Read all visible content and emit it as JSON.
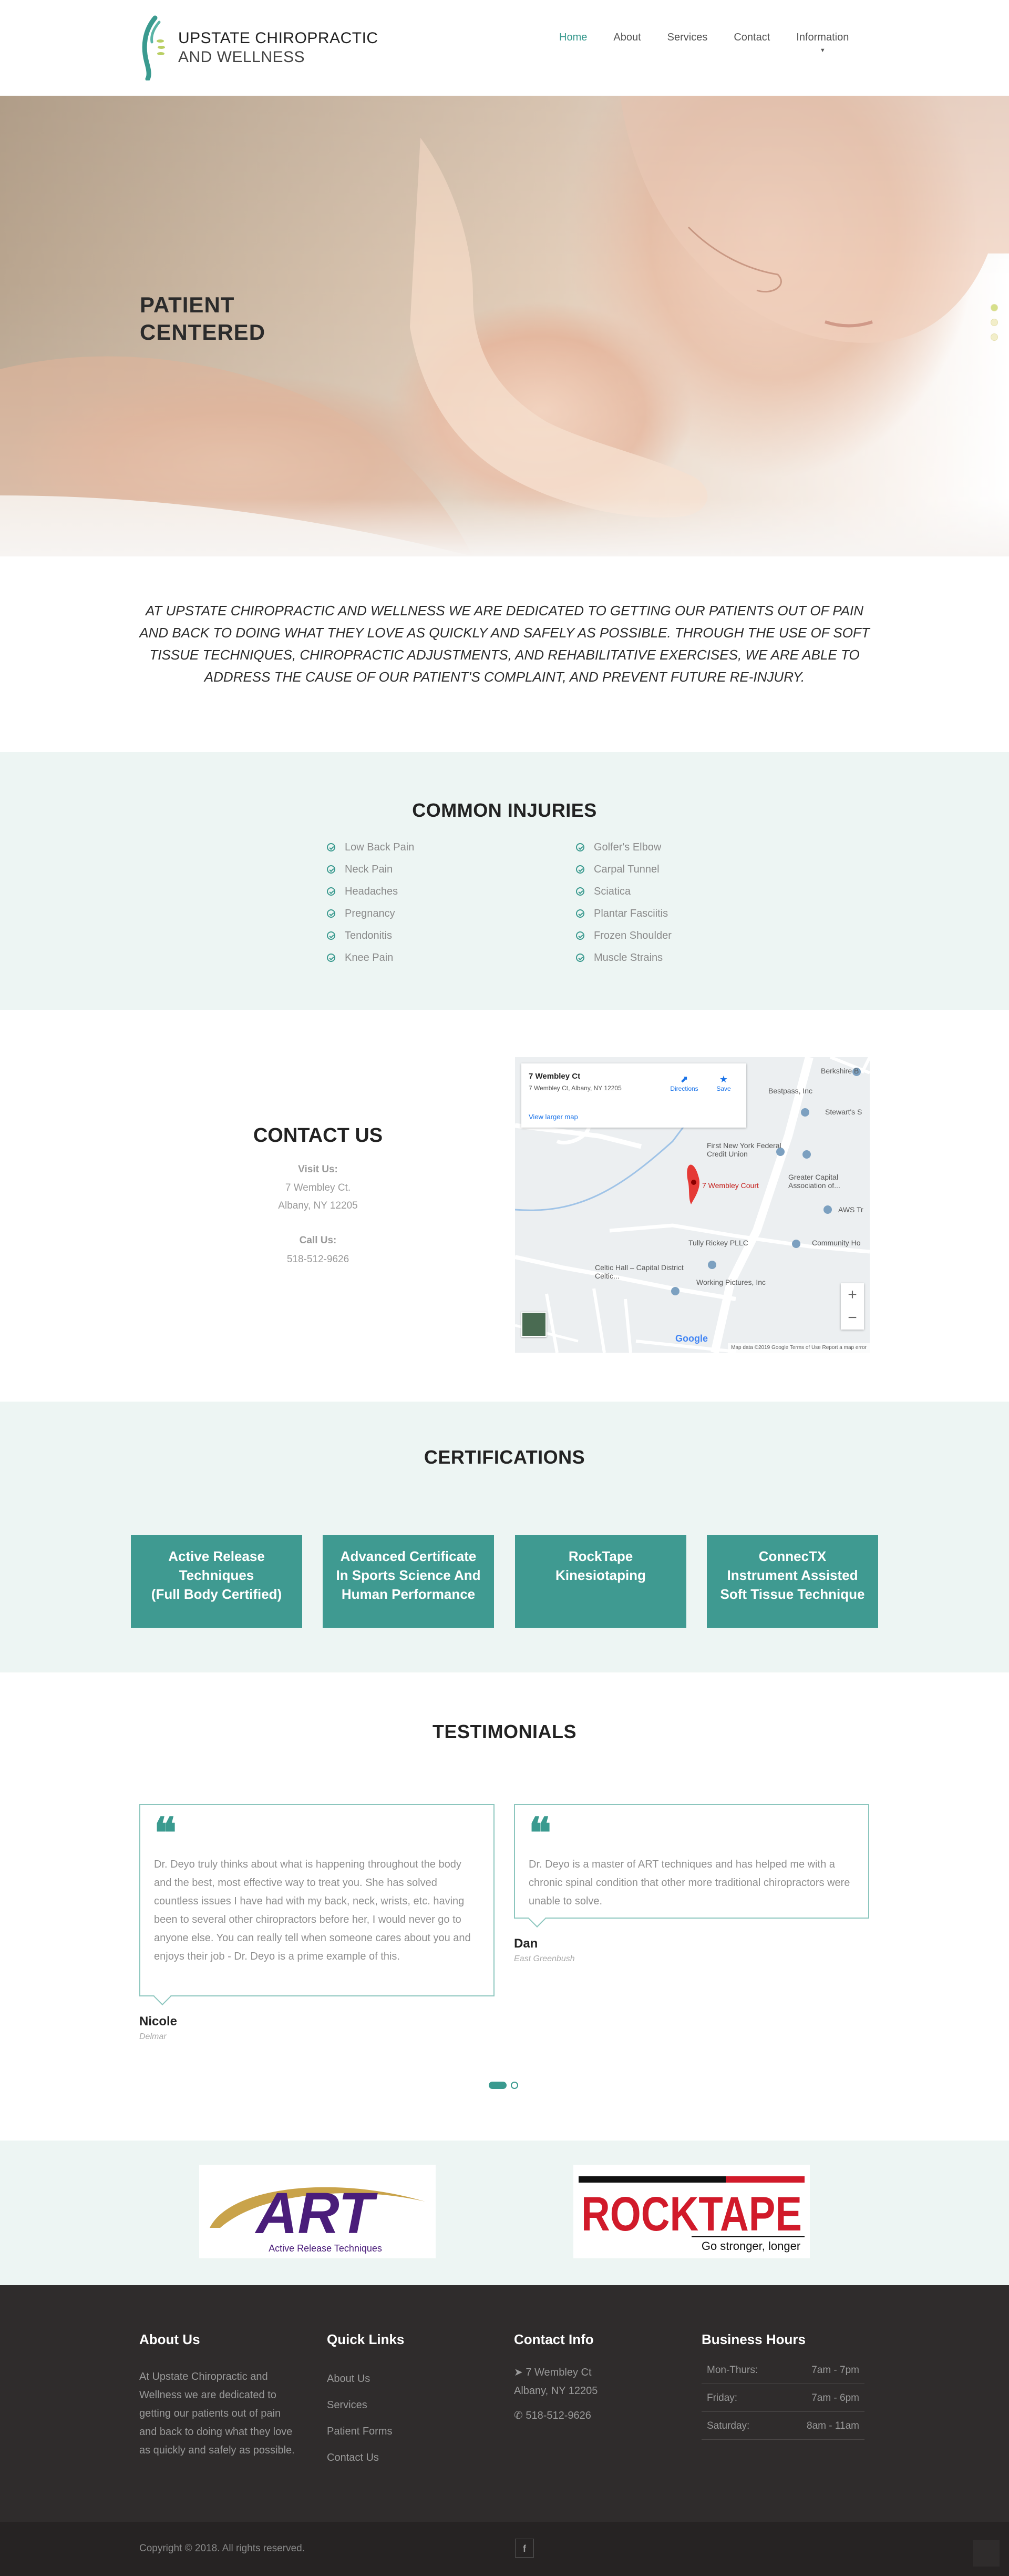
{
  "brand": {
    "line1": "UPSTATE CHIROPRACTIC",
    "line2": "AND WELLNESS",
    "accent": "#3a9a8f",
    "dark_bg": "#2f2c2c",
    "light_bg": "#edf5f3"
  },
  "nav": {
    "items": [
      "Home",
      "About",
      "Services",
      "Contact",
      "Information"
    ],
    "active": "Home"
  },
  "hero": {
    "title_line1": "PATIENT",
    "title_line2": "CENTERED",
    "slides": 3,
    "active_slide": 1
  },
  "intro": {
    "text": "AT UPSTATE CHIROPRACTIC AND WELLNESS WE ARE DEDICATED TO GETTING OUR PATIENTS OUT OF PAIN AND BACK TO DOING WHAT THEY LOVE AS QUICKLY AND SAFELY AS POSSIBLE. THROUGH THE USE OF SOFT TISSUE TECHNIQUES, CHIROPRACTIC ADJUSTMENTS, AND REHABILITATIVE EXERCISES, WE ARE ABLE TO ADDRESS THE CAUSE OF OUR PATIENT'S COMPLAINT, AND PREVENT FUTURE RE-INJURY."
  },
  "injuries": {
    "title": "COMMON INJURIES",
    "left": [
      "Low Back Pain",
      "Neck Pain",
      "Headaches",
      "Pregnancy",
      "Tendonitis",
      "Knee Pain"
    ],
    "right": [
      "Golfer's Elbow",
      "Carpal Tunnel",
      "Sciatica",
      "Plantar Fasciitis",
      "Frozen Shoulder",
      "Muscle Strains"
    ]
  },
  "contact": {
    "title": "CONTACT US",
    "visit_label": "Visit Us:",
    "address1": "7 Wembley Ct.",
    "address2": "Albany, NY 12205",
    "call_label": "Call Us:",
    "phone": "518-512-9626"
  },
  "map": {
    "place": "7 Wembley Ct",
    "address": "7 Wembley Ct, Albany, NY 12205",
    "directions": "Directions",
    "save": "Save",
    "larger": "View larger map",
    "pin_label": "7 Wembley Court",
    "labels": [
      "Berkshire B",
      "Bestpass, Inc",
      "Stewart's S",
      "First New York Federal Credit Union",
      "Greater Capital Association of...",
      "AWS Tr",
      "Community Ho",
      "Tully Rickey PLLC",
      "Celtic Hall – Capital District Celtic...",
      "Working Pictures, Inc"
    ],
    "footer": "Map data ©2019 Google   Terms of Use   Report a map error",
    "google": "Google"
  },
  "certifications": {
    "title": "CERTIFICATIONS",
    "items": [
      [
        "Active Release",
        "Techniques",
        "(Full Body Certified)"
      ],
      [
        "Advanced Certificate",
        "In Sports Science And",
        "Human Performance"
      ],
      [
        "RockTape",
        "Kinesiotaping"
      ],
      [
        "ConnecTX",
        "Instrument Assisted",
        "Soft Tissue Technique"
      ]
    ]
  },
  "testimonials": {
    "title": "TESTIMONIALS",
    "items": [
      {
        "text": "Dr. Deyo truly thinks about what is happening throughout the body and the best, most effective way to treat you. She has solved countless issues I have had with my back, neck, wrists, etc. having been to several other chiropractors before her, I would never go to anyone else. You can really tell when someone cares about you and enjoys their job - Dr. Deyo is a prime example of this.",
        "name": "Nicole",
        "location": "Delmar"
      },
      {
        "text": "Dr. Deyo is a master of ART techniques and has helped me with a chronic spinal condition that other more traditional chiropractors were unable to solve.",
        "name": "Dan",
        "location": "East Greenbush"
      }
    ]
  },
  "partners": {
    "art": {
      "word": "ART",
      "caption": "Active Release Techniques"
    },
    "rocktape": {
      "word": "ROCKTAPE",
      "caption": "Go stronger, longer"
    }
  },
  "footer": {
    "about_title": "About Us",
    "about_text": "At Upstate Chiropractic and Wellness we are dedicated to getting our patients out of pain and back to doing what they love as quickly and safely as possible.",
    "links_title": "Quick Links",
    "links": [
      "About Us",
      "Services",
      "Patient Forms",
      "Contact Us"
    ],
    "contact_title": "Contact Info",
    "contact_address1": "7 Wembley Ct",
    "contact_address2": "Albany, NY 12205",
    "contact_phone": "518-512-9626",
    "hours_title": "Business Hours",
    "hours": [
      [
        "Mon-Thurs:",
        "7am - 7pm"
      ],
      [
        "Friday:",
        "7am - 6pm"
      ],
      [
        "Saturday:",
        "8am - 11am"
      ]
    ],
    "copyright": "Copyright © 2018. All rights reserved.",
    "social": "f"
  }
}
